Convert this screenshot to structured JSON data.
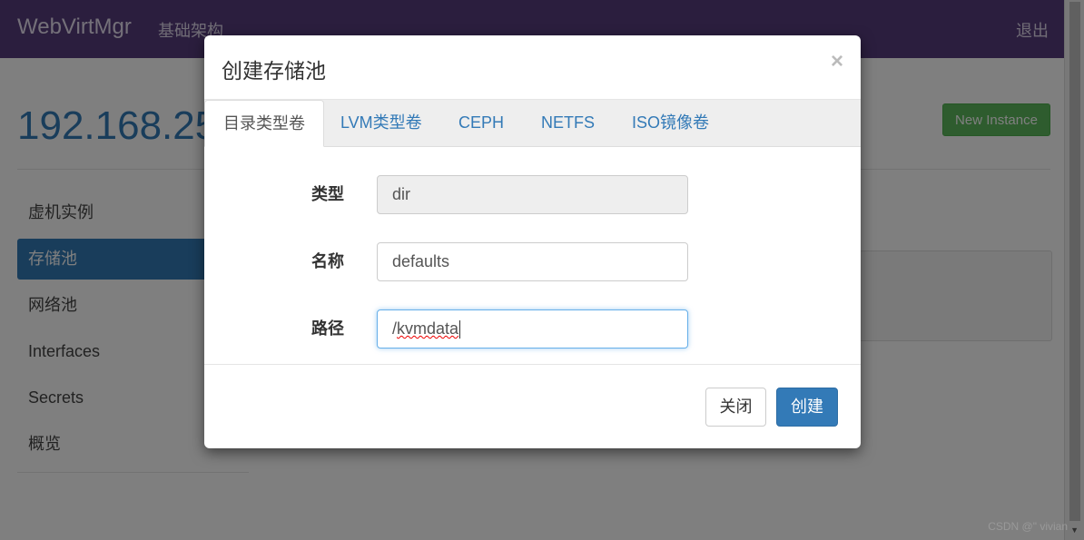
{
  "navbar": {
    "brand": "WebVirtMgr",
    "nav_link": "基础架构",
    "logout": "退出"
  },
  "page": {
    "host_title": "192.168.25",
    "new_instance": "New Instance",
    "sidebar": [
      {
        "label": "虚机实例",
        "active": false
      },
      {
        "label": "存储池",
        "active": true
      },
      {
        "label": "网络池",
        "active": false
      },
      {
        "label": "Interfaces",
        "active": false
      },
      {
        "label": "Secrets",
        "active": false
      },
      {
        "label": "概览",
        "active": false
      }
    ]
  },
  "modal": {
    "title": "创建存储池",
    "close_symbol": "×",
    "tabs": [
      {
        "label": "目录类型卷",
        "active": true
      },
      {
        "label": "LVM类型卷"
      },
      {
        "label": "CEPH"
      },
      {
        "label": "NETFS"
      },
      {
        "label": "ISO镜像卷"
      }
    ],
    "fields": {
      "type": {
        "label": "类型",
        "value": "dir"
      },
      "name": {
        "label": "名称",
        "value": "defaults"
      },
      "path": {
        "label": "路径",
        "value_prefix": "/",
        "value_rest": "kvmdata"
      }
    },
    "buttons": {
      "close": "关闭",
      "create": "创建"
    }
  },
  "watermark": "CSDN @\" vivian",
  "colors": {
    "navbar": "#563d7c",
    "primary": "#337ab7",
    "success": "#5cb85c"
  }
}
